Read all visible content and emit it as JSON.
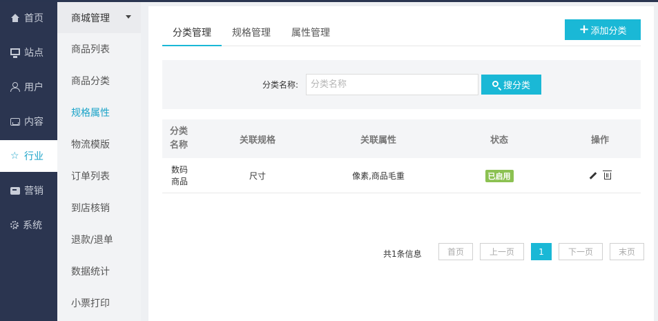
{
  "nav": {
    "items": [
      {
        "label": "首页",
        "icon": "home-icon"
      },
      {
        "label": "站点",
        "icon": "monitor-icon"
      },
      {
        "label": "用户",
        "icon": "user-icon"
      },
      {
        "label": "内容",
        "icon": "inbox-icon"
      },
      {
        "label": "行业",
        "icon": "star-icon"
      },
      {
        "label": "营销",
        "icon": "market-icon"
      },
      {
        "label": "系统",
        "icon": "gear-icon"
      }
    ],
    "active": "行业"
  },
  "subnav": {
    "header": "商城管理",
    "items": [
      "商品列表",
      "商品分类",
      "规格属性",
      "物流模版",
      "订单列表",
      "到店核销",
      "退款/退单",
      "数据统计",
      "小票打印"
    ],
    "active": "规格属性"
  },
  "tabs": [
    "分类管理",
    "规格管理",
    "属性管理"
  ],
  "active_tab": "分类管理",
  "add_button": {
    "plus": "+",
    "label": "添加分类"
  },
  "search": {
    "label": "分类名称:",
    "placeholder": "分类名称",
    "value": "",
    "button_label": "搜分类"
  },
  "table": {
    "headers": [
      "分类\n名称",
      "关联规格",
      "关联属性",
      "状态",
      "操作"
    ],
    "rows": [
      {
        "name": "数码\n商品",
        "spec": "尺寸",
        "attrs": "像素,商品毛重",
        "status": "已启用"
      }
    ]
  },
  "pagination": {
    "total_text": "共1条信息",
    "first": "首页",
    "prev": "上一页",
    "current": "1",
    "next": "下一页",
    "last": "末页"
  },
  "colors": {
    "nav_bg": "#2b3550",
    "accent": "#1ab8d6",
    "active_text": "#1aa3c8",
    "status_green": "#8cc152"
  }
}
